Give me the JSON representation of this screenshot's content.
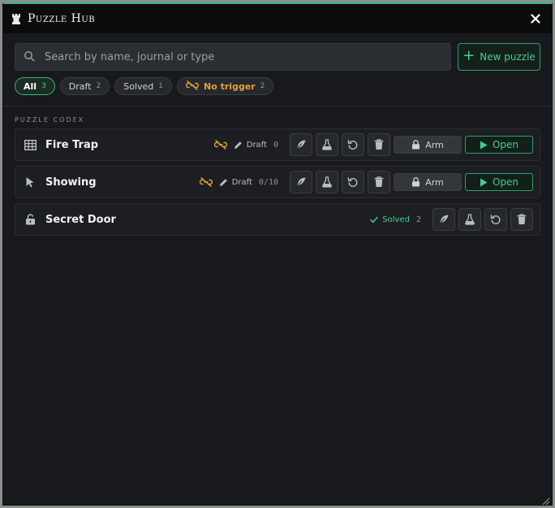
{
  "window": {
    "title": "Puzzle Hub"
  },
  "search": {
    "placeholder": "Search by name, journal or type"
  },
  "new_button": {
    "label": "New puzzle"
  },
  "filters": [
    {
      "label": "All",
      "count": "3"
    },
    {
      "label": "Draft",
      "count": "2"
    },
    {
      "label": "Solved",
      "count": "1"
    },
    {
      "label": "No trigger",
      "count": "2"
    }
  ],
  "section": {
    "label": "Puzzle Codex"
  },
  "puzzles": [
    {
      "name": "Fire Trap",
      "icon": "grid-icon",
      "status": "Draft",
      "count": "0",
      "arm": "Arm",
      "open": "Open"
    },
    {
      "name": "Showing",
      "icon": "pointer-icon",
      "status": "Draft",
      "count": "0/10",
      "arm": "Arm",
      "open": "Open"
    },
    {
      "name": "Secret Door",
      "icon": "unlock-icon",
      "status": "Solved",
      "count": "2"
    }
  ],
  "colors": {
    "accent": "#3fd08f",
    "warning": "#e0a33a",
    "background": "#17191c"
  }
}
